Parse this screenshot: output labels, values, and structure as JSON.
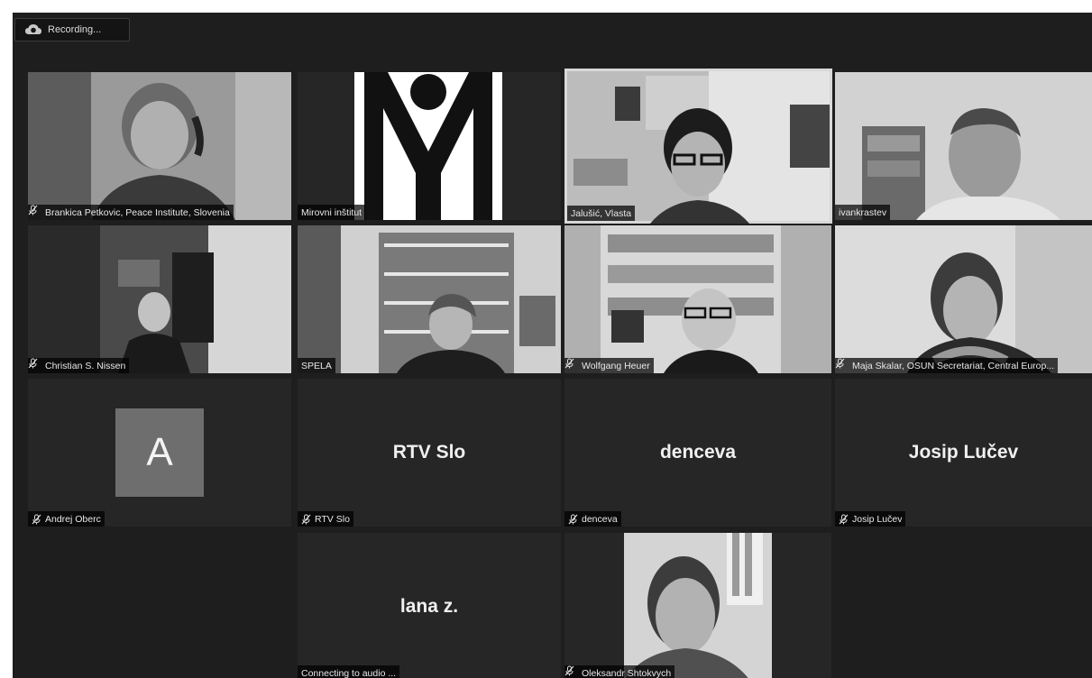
{
  "recording": {
    "label": "Recording..."
  },
  "participants": [
    {
      "name": "Brankica Petkovic, Peace Institute, Slovenia",
      "muted": true
    },
    {
      "name": "Mirovni inštitut",
      "muted": false
    },
    {
      "name": "Jalušić, Vlasta",
      "muted": false,
      "active_speaker": true
    },
    {
      "name": "ivankrastev",
      "muted": false
    },
    {
      "name": "Christian S. Nissen",
      "muted": true
    },
    {
      "name": "SPELA",
      "muted": false
    },
    {
      "name": "Wolfgang Heuer",
      "muted": true
    },
    {
      "name": "Maja Skalar, OSUN Secretariat, Central Europ...",
      "muted": true
    },
    {
      "name": "Andrej Oberc",
      "muted": true,
      "avatar_letter": "A"
    },
    {
      "name": "RTV Slo",
      "muted": true,
      "display": "RTV Slo"
    },
    {
      "name": "denceva",
      "muted": true,
      "display": "denceva"
    },
    {
      "name": "Josip Lučev",
      "muted": true,
      "display": "Josip Lučev"
    },
    {
      "name": "Connecting to audio ...",
      "muted": false,
      "display": "lana z."
    },
    {
      "name": "Oleksandr Shtokvych",
      "muted": true
    }
  ],
  "colors": {
    "background": "#1e1e1e",
    "tile": "#262626",
    "active_border": "#d8d8d8"
  },
  "icons": {
    "recording": "cloud-record-icon",
    "muted": "mic-muted-icon"
  }
}
